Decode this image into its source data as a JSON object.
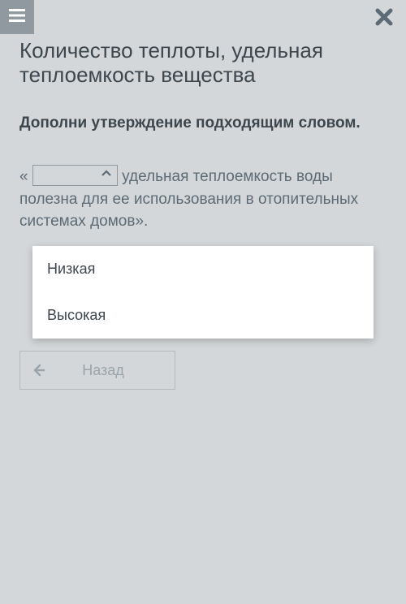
{
  "header": {
    "menu_icon": "hamburger",
    "close_icon": "close"
  },
  "title": "Количество теплоты, удельная теплоемкость вещества",
  "instruction": "Дополни утверждение подходящим словом.",
  "sentence": {
    "open_quote": "«",
    "after_dropdown": " удельная теплоемкость воды полезна для ее использования в отопительных системах домов».",
    "dropdown_value": ""
  },
  "dropdown_options": [
    "Низкая",
    "Высокая"
  ],
  "back_label": "Назад"
}
